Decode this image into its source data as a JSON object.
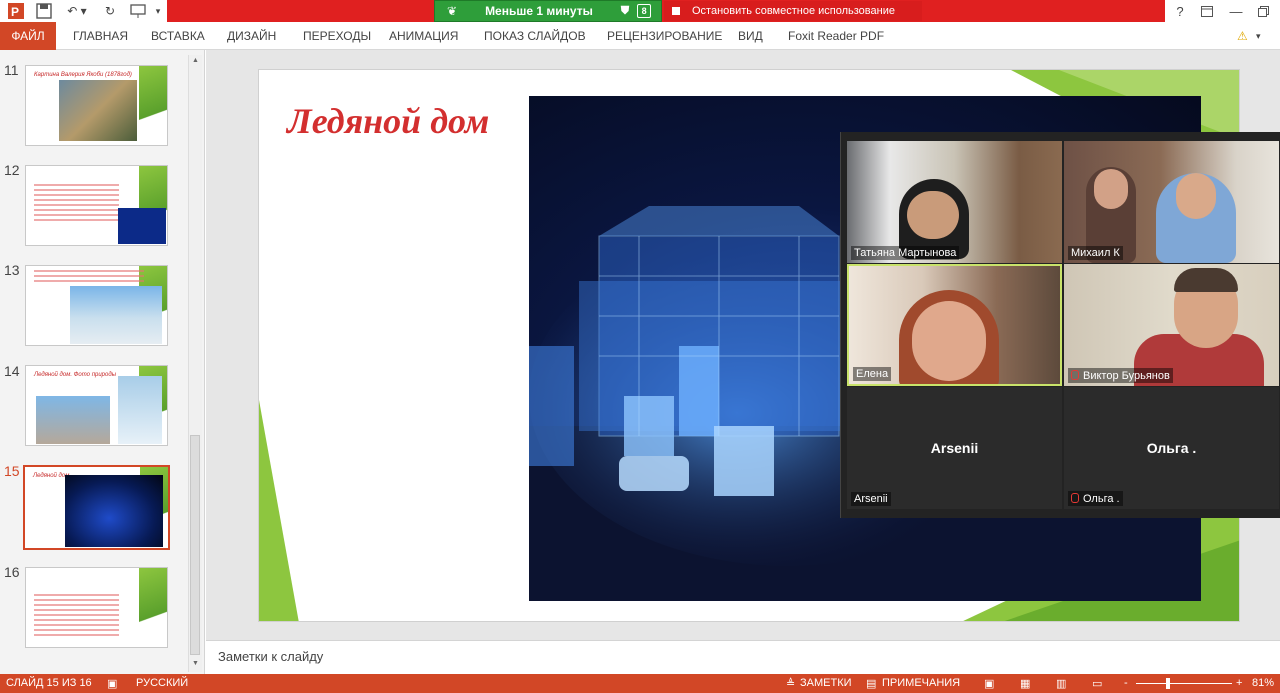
{
  "titlebar": {
    "sharing_timer": "Меньше 1 минуты",
    "stop_sharing": "Остановить совместное использование",
    "help": "?",
    "recording_badge": "8"
  },
  "ribbon": {
    "tabs": [
      "ФАЙЛ",
      "ГЛАВНАЯ",
      "ВСТАВКА",
      "ДИЗАЙН",
      "ПЕРЕХОДЫ",
      "АНИМАЦИЯ",
      "ПОКАЗ СЛАЙДОВ",
      "РЕЦЕНЗИРОВАНИЕ",
      "ВИД",
      "Foxit Reader PDF"
    ]
  },
  "thumbnails": [
    {
      "num": "11",
      "title": "Картина Валерия Якоби (1878год)"
    },
    {
      "num": "12",
      "title": ""
    },
    {
      "num": "13",
      "title": ""
    },
    {
      "num": "14",
      "title": "Ледяной дом. Фото природы"
    },
    {
      "num": "15",
      "title": "Ледяной дом",
      "selected": true
    },
    {
      "num": "16",
      "title": ""
    }
  ],
  "slide": {
    "title": "Ледяной дом"
  },
  "zoom": {
    "participants": [
      {
        "name": "Татьяна Мартынова",
        "muted": false,
        "video": true
      },
      {
        "name": "Михаил К",
        "muted": false,
        "video": true
      },
      {
        "name": "Елена",
        "muted": false,
        "video": true,
        "active_speaker": true
      },
      {
        "name": "Виктор Бурьянов",
        "muted": true,
        "video": true
      },
      {
        "name": "Arsenii",
        "label": "Arsenii",
        "muted": false,
        "video": false
      },
      {
        "name": "Ольга .",
        "label": "Ольга .",
        "muted": true,
        "video": false
      }
    ]
  },
  "notes": {
    "placeholder": "Заметки к слайду"
  },
  "statusbar": {
    "slide_info": "СЛАЙД 15 ИЗ 16",
    "language": "РУССКИЙ",
    "notes_btn": "ЗАМЕТКИ",
    "comments_btn": "ПРИМЕЧАНИЯ",
    "zoom_level": "81%",
    "zoom_minus": "-",
    "zoom_plus": "+"
  },
  "colors": {
    "accent": "#d24726",
    "share_red": "#e02020",
    "share_green": "#2e9e3a",
    "slide_title": "#d32f2f",
    "slide_green": "#8dc63f"
  }
}
